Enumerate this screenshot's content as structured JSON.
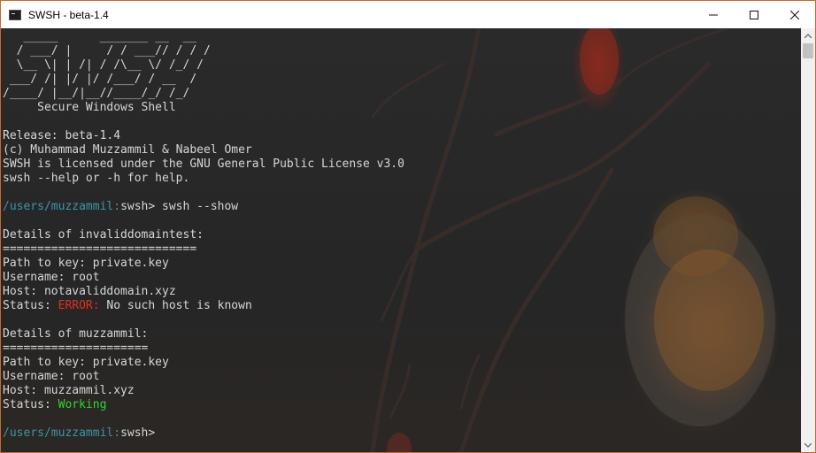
{
  "window": {
    "title": "SWSH - beta-1.4",
    "accent_border": "#c46a2f",
    "controls": [
      "minimize-icon",
      "maximize-icon",
      "close-icon"
    ]
  },
  "terminal": {
    "banner": [
      "   _____      _______ __  __",
      "  / ___/ |     / / ___// / / /",
      "  \\__ \\| | /| / /\\__ \\/ /_/ /",
      " ___/ /| |/ |/ /___/ / __  /",
      "/____/ |__/|__//____/_/ /_/",
      "     Secure Windows Shell"
    ],
    "info": {
      "release": "Release: beta-1.4",
      "copyright": "(c) Muhammad Muzzammil & Nabeel Omer",
      "license": "SWSH is licensed under the GNU General Public License v3.0",
      "help": "swsh --help or -h for help."
    },
    "prompt1": {
      "path": "/users/muzzammil:",
      "prefix": "swsh> ",
      "command": "swsh --show"
    },
    "entries": [
      {
        "header": "Details of invaliddomaintest:",
        "separator": "============================",
        "key_line": "Path to key: private.key",
        "user_line": "Username: root",
        "host_line": "Host: notavaliddomain.xyz",
        "status_label": "Status: ",
        "status_value": "ERROR:",
        "status_rest": " No such host is known"
      },
      {
        "header": "Details of muzzammil:",
        "separator": "=====================",
        "key_line": "Path to key: private.key",
        "user_line": "Username: root",
        "host_line": "Host: muzzammil.xyz",
        "status_label": "Status: ",
        "status_value": "Working",
        "status_rest": ""
      }
    ],
    "prompt2": {
      "path": "/users/muzzammil:",
      "prefix": "swsh> ",
      "command": ""
    },
    "colors": {
      "prompt": "#3a96a8",
      "error": "#e0301e",
      "ok": "#2fd62f",
      "text": "#d6d6d6"
    }
  }
}
